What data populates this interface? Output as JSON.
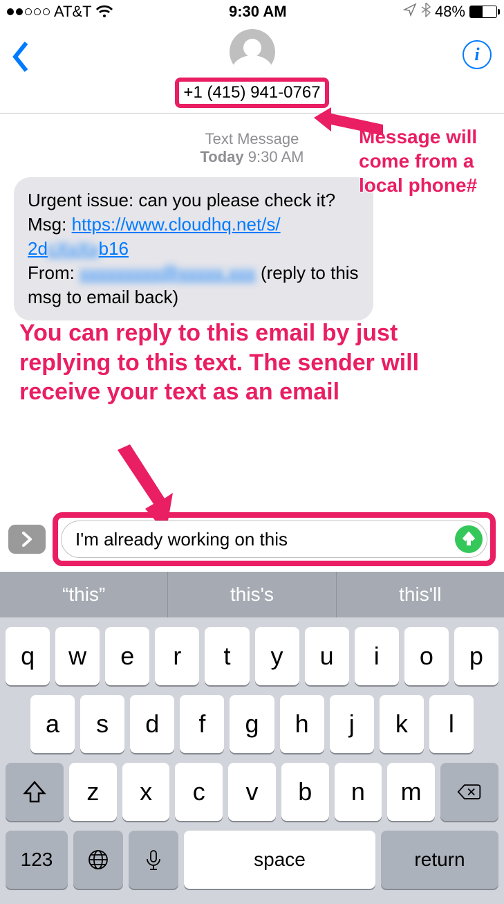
{
  "status": {
    "carrier": "AT&T",
    "time": "9:30 AM",
    "battery_pct": "48%",
    "battery_level_pct": 48
  },
  "nav": {
    "phone_number": "+1 (415) 941-0767"
  },
  "thread": {
    "type_label": "Text Message",
    "today_label": "Today",
    "time": "9:30 AM",
    "msg": {
      "line1": "Urgent issue: can you please check it?",
      "msg_prefix": "Msg: ",
      "link_text_a": "https://www.cloudhq.net/s/",
      "link_text_b_prefix": "2d",
      "link_text_b_blurred": "cXxXx",
      "link_text_b_suffix": "b16",
      "from_prefix": "From: ",
      "from_blurred": "xxxxxxxxx@xxxxx.xxx",
      "from_suffix": " (reply to this msg to email back)"
    }
  },
  "compose": {
    "value": "I'm already working on this"
  },
  "suggestions": [
    "“this”",
    "this's",
    "this'll"
  ],
  "keyboard": {
    "row1": [
      "q",
      "w",
      "e",
      "r",
      "t",
      "y",
      "u",
      "i",
      "o",
      "p"
    ],
    "row2": [
      "a",
      "s",
      "d",
      "f",
      "g",
      "h",
      "j",
      "k",
      "l"
    ],
    "row3": [
      "z",
      "x",
      "c",
      "v",
      "b",
      "n",
      "m"
    ],
    "num_label": "123",
    "space_label": "space",
    "return_label": "return"
  },
  "annotations": {
    "right_note": "Message will come from a local phone#",
    "main_note": "You can reply to this email by just replying to this text. The sender will receive your text as an email"
  }
}
